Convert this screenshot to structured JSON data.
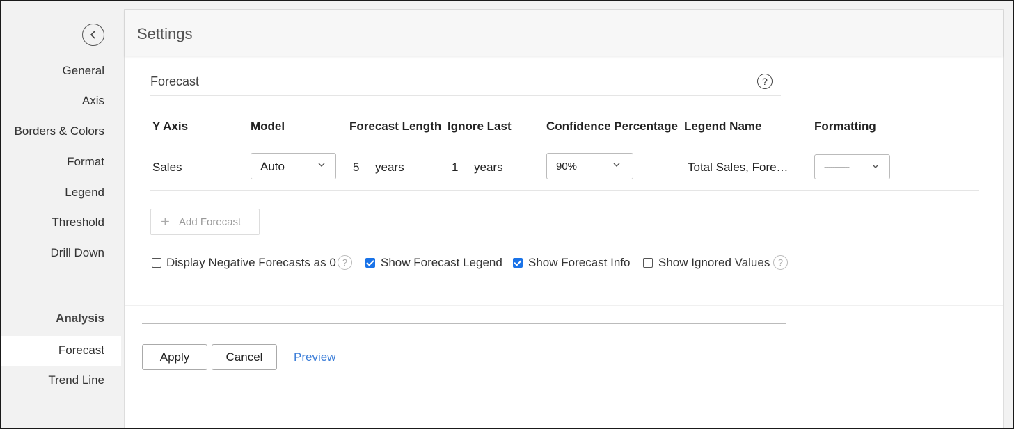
{
  "sidebar": {
    "items": [
      {
        "label": "General"
      },
      {
        "label": "Axis"
      },
      {
        "label": "Borders & Colors"
      },
      {
        "label": "Format"
      },
      {
        "label": "Legend"
      },
      {
        "label": "Threshold"
      },
      {
        "label": "Drill Down"
      }
    ],
    "analysis_heading": "Analysis",
    "analysis_items": [
      {
        "label": "Forecast",
        "active": true
      },
      {
        "label": "Trend Line",
        "active": false
      }
    ]
  },
  "panel": {
    "title": "Settings",
    "section_title": "Forecast",
    "help_glyph": "?"
  },
  "table": {
    "headers": [
      "Y Axis",
      "Model",
      "Forecast Length",
      "Ignore Last",
      "Confidence Percentage",
      "Legend Name",
      "Formatting"
    ],
    "rows": [
      {
        "y_axis": "Sales",
        "model": "Auto",
        "forecast_length": "5",
        "forecast_length_unit": "years",
        "ignore_last": "1",
        "ignore_last_unit": "years",
        "confidence": "90%",
        "legend_name": "Total Sales, Fore…",
        "formatting": "------------"
      }
    ]
  },
  "add_forecast_label": "Add Forecast",
  "options": [
    {
      "label": "Display Negative Forecasts as 0",
      "checked": false,
      "help": true
    },
    {
      "label": "Show Forecast Legend",
      "checked": true,
      "help": false
    },
    {
      "label": "Show Forecast Info",
      "checked": true,
      "help": false
    },
    {
      "label": "Show Ignored Values",
      "checked": false,
      "help": true
    }
  ],
  "footer": {
    "apply_label": "Apply",
    "cancel_label": "Cancel",
    "preview_label": "Preview"
  },
  "colors": {
    "accent": "#1a73e8",
    "link": "#3b7dd8",
    "sidebar_bg": "#f2f2f2"
  }
}
